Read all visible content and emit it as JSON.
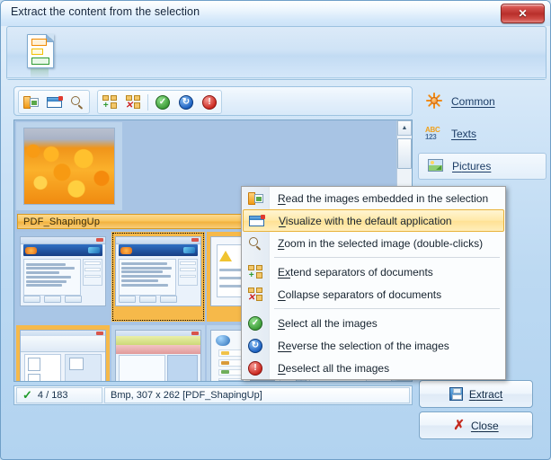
{
  "window": {
    "title": "Extract the content from the selection",
    "close_glyph": "✕"
  },
  "toolbar": {
    "buttons": [
      {
        "name": "read-images",
        "tooltip": "Read the images embedded in the selection"
      },
      {
        "name": "visualize-default-app",
        "tooltip": "Visualize with the default application"
      },
      {
        "name": "zoom-image",
        "tooltip": "Zoom in the selected image (double-clicks)"
      },
      {
        "name": "extend-separators",
        "tooltip": "Extend separators of documents"
      },
      {
        "name": "collapse-separators",
        "tooltip": "Collapse separators of documents"
      },
      {
        "name": "select-all",
        "tooltip": "Select all the images"
      },
      {
        "name": "reverse-selection",
        "tooltip": "Reverse the selection of the images"
      },
      {
        "name": "deselect-all",
        "tooltip": "Deselect all the images"
      }
    ]
  },
  "context_menu": {
    "items": [
      {
        "id": "read",
        "accel": "R",
        "rest": "ead the images embedded in the selection",
        "icon": "read-images-icon",
        "highlight": false
      },
      {
        "id": "visualize",
        "accel": "V",
        "rest": "isualize with the default application",
        "icon": "visualize-window-icon",
        "highlight": true
      },
      {
        "id": "zoom",
        "accel": "Z",
        "rest": "oom in the selected image (double-clicks)",
        "icon": "magnifier-icon",
        "highlight": false
      },
      {
        "id": "extend",
        "accel": "Ex",
        "rest": "tend separators of documents",
        "icon": "extend-separators-icon",
        "highlight": false
      },
      {
        "id": "collapse",
        "accel": "C",
        "rest": "ollapse separators of documents",
        "icon": "collapse-separators-icon",
        "highlight": false
      },
      {
        "id": "select-all",
        "accel": "S",
        "rest": "elect all the images",
        "icon": "green-check-circle-icon",
        "highlight": false
      },
      {
        "id": "reverse",
        "accel": "Re",
        "rest": "verse the selection of the images",
        "icon": "blue-arrow-circle-icon",
        "highlight": false
      },
      {
        "id": "deselect-all",
        "accel": "D",
        "rest": "eselect all the images",
        "icon": "red-exclamation-circle-icon",
        "highlight": false
      }
    ]
  },
  "group_separator": {
    "label": "PDF_ShapingUp"
  },
  "status": {
    "check_glyph": "✓",
    "count": "4 / 183",
    "info": "Bmp, 307 x 262 [PDF_ShapingUp]"
  },
  "sidebar": {
    "items": [
      {
        "label": "Common",
        "accel": "C",
        "rest": "ommon",
        "icon": "sun-gear-icon",
        "selected": false
      },
      {
        "label": "Texts",
        "accel": "T",
        "rest": "exts",
        "icon": "abc123-icon",
        "selected": false
      },
      {
        "label": "Pictures",
        "accel": "Pi",
        "rest": "ctures",
        "icon": "picture-icon",
        "selected": true
      }
    ],
    "abc_top": "ABC",
    "abc_bottom": "123"
  },
  "actions": {
    "extract": {
      "accel": "E",
      "rest": "xtract",
      "icon": "floppy-save-icon"
    },
    "close": {
      "accel": "C",
      "rest": "lose",
      "icon": "red-x-icon",
      "glyph": "✗"
    }
  },
  "scrollbar": {
    "up_glyph": "▲",
    "down_glyph": "▼"
  },
  "colors": {
    "accent_orange": "#f2b13c",
    "selection_blue": "#a9c6e6",
    "highlight_yellow": "#ffe194",
    "title_text": "#15263c"
  }
}
